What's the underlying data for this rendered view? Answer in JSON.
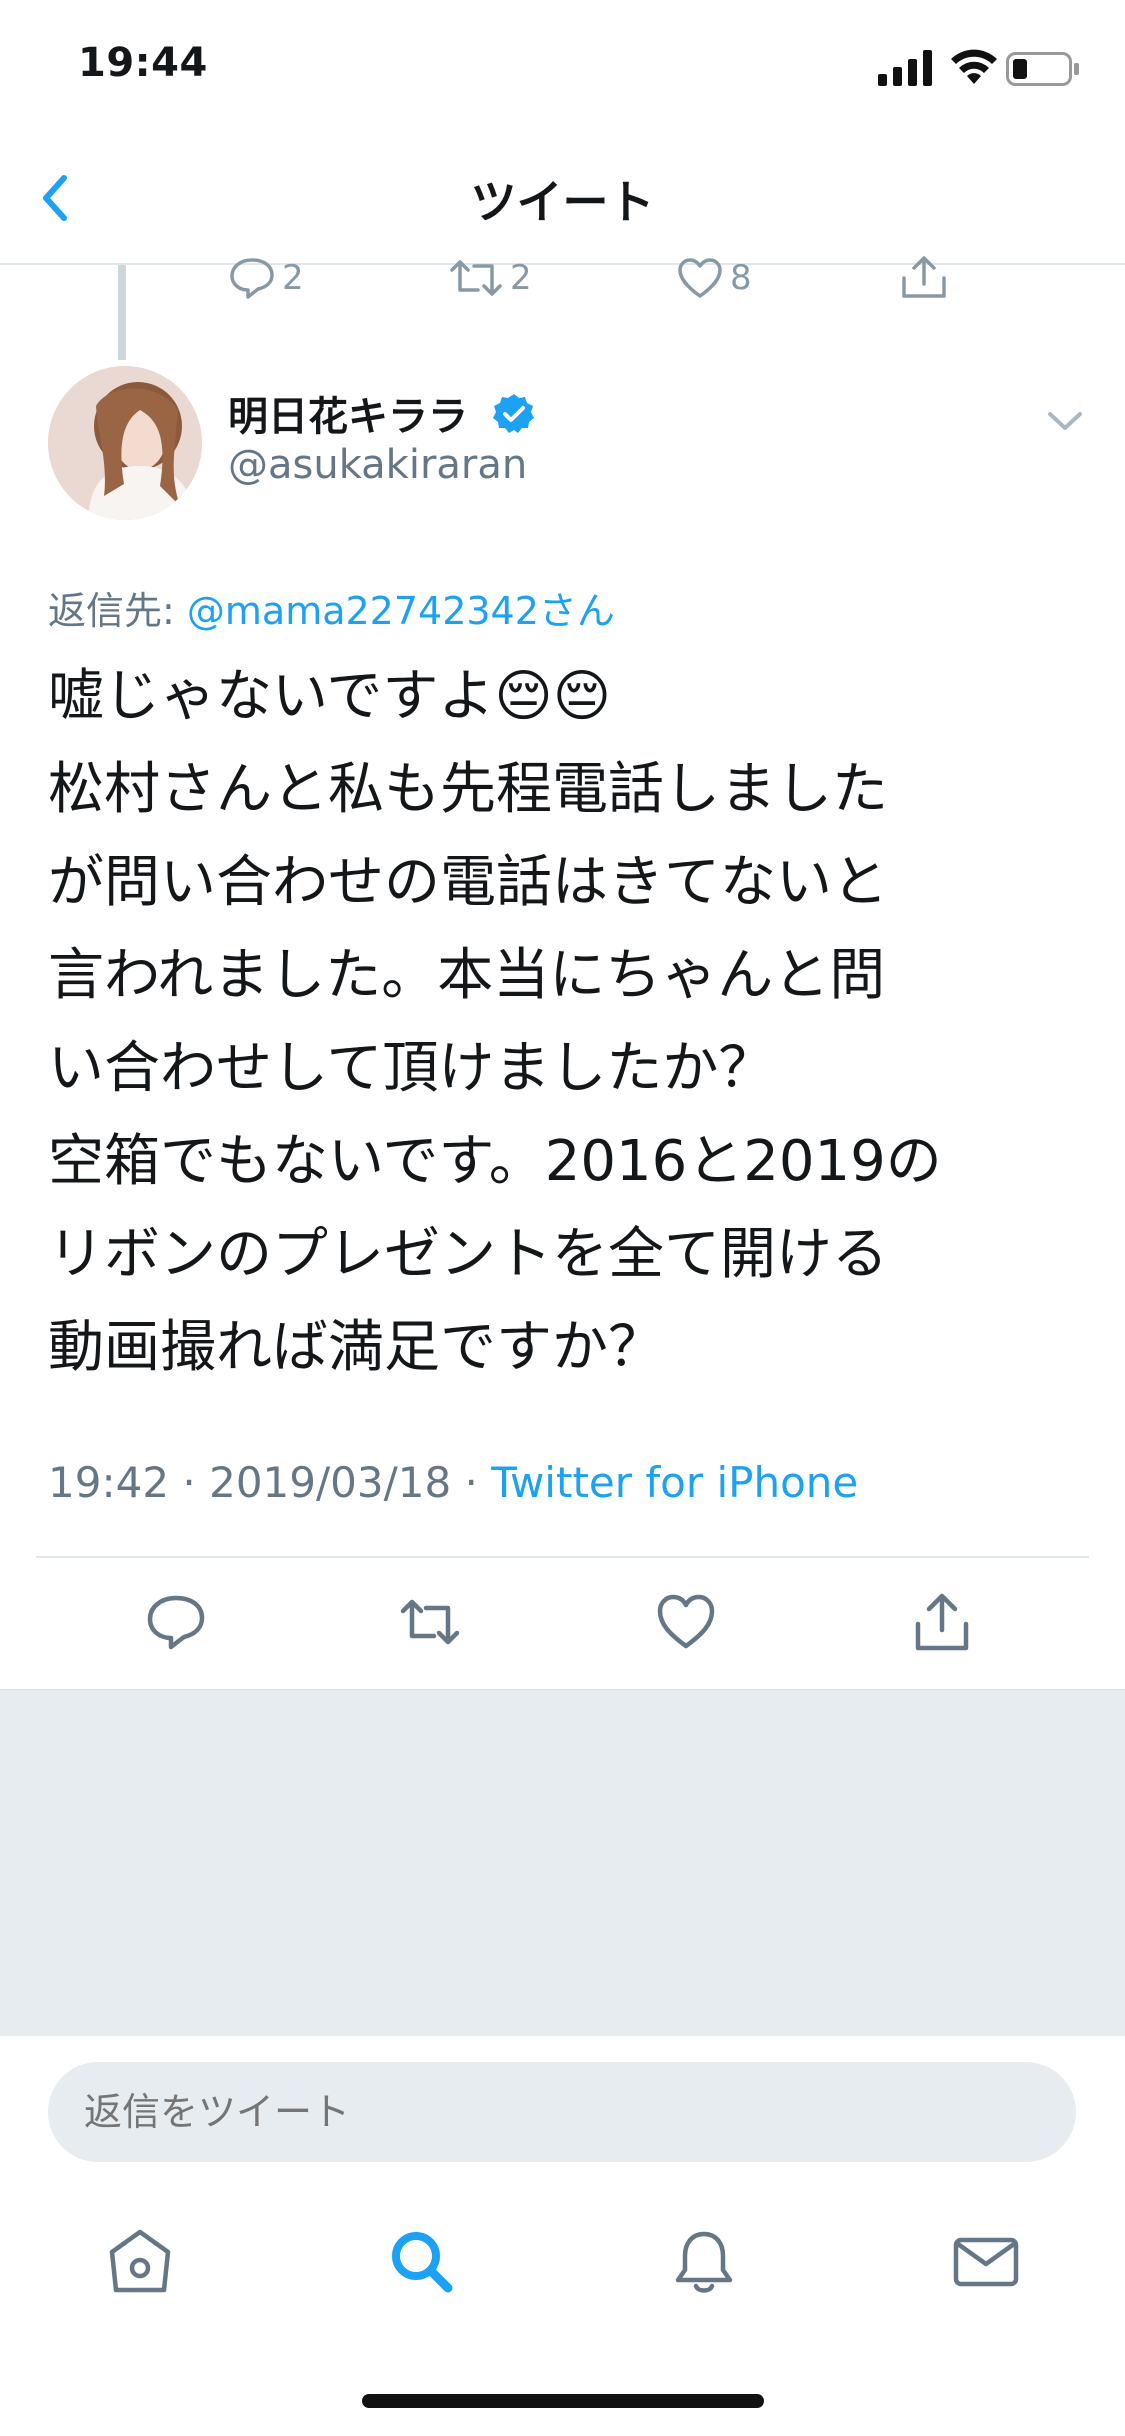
{
  "status_bar": {
    "time": "19:44"
  },
  "nav": {
    "title": "ツイート"
  },
  "prev_tweet": {
    "reply_count": "2",
    "retweet_count": "2",
    "like_count": "8"
  },
  "tweet": {
    "display_name": "明日花キララ",
    "username": "@asukakiraran",
    "reply_prefix": "返信先: ",
    "reply_mention": "@mama22742342さん",
    "text": "嘘じゃないですよ😔😔\n松村さんと私も先程電話しました\nが問い合わせの電話はきてないと\n言われました。本当にちゃんと問\nい合わせして頂けましたか？\n空箱でもないです。2016と2019の\nリボンのプレゼントを全て開ける\n動画撮れば満足ですか？",
    "time": "19:42",
    "date": "2019/03/18",
    "separator": " · ",
    "source": "Twitter for iPhone"
  },
  "reply_bar": {
    "placeholder": "返信をツイート"
  },
  "icons": [
    "back-icon",
    "reply-icon",
    "retweet-icon",
    "like-icon",
    "share-icon",
    "verified-icon",
    "chevron-down-icon",
    "home-icon",
    "search-icon",
    "notifications-icon",
    "messages-icon"
  ],
  "colors": {
    "accent": "#1da1f2",
    "secondary_text": "#657786",
    "icon_gray": "#657786",
    "divider": "#e1e8ed",
    "background_gray": "#e6ecf0"
  }
}
